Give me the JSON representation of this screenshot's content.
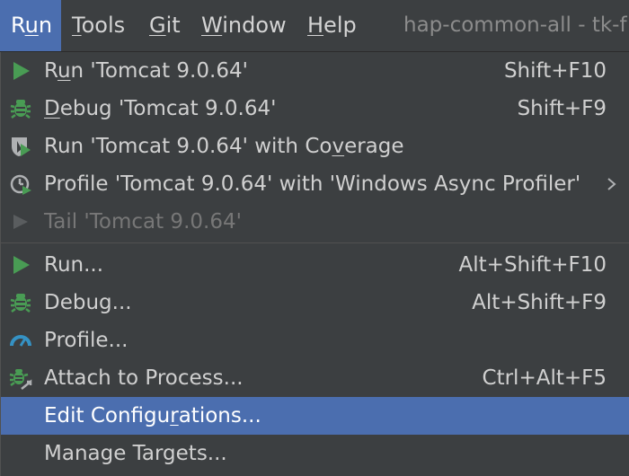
{
  "menubar": {
    "items": [
      {
        "pre": "R",
        "ul": "u",
        "post": "n"
      },
      {
        "pre": "",
        "ul": "T",
        "post": "ools"
      },
      {
        "pre": "",
        "ul": "G",
        "post": "it"
      },
      {
        "pre": "",
        "ul": "W",
        "post": "indow"
      },
      {
        "pre": "",
        "ul": "H",
        "post": "elp"
      }
    ],
    "window_title": "hap-common-all - tk-f"
  },
  "menu": {
    "items": [
      {
        "pre": "R",
        "ul": "u",
        "post": "n 'Tomcat 9.0.64'",
        "shortcut": "Shift+F10",
        "icon": "run-icon"
      },
      {
        "pre": "",
        "ul": "D",
        "post": "ebug 'Tomcat 9.0.64'",
        "shortcut": "Shift+F9",
        "icon": "debug-icon"
      },
      {
        "pre": "Run 'Tomcat 9.0.64' with Co",
        "ul": "v",
        "post": "erage",
        "shortcut": "",
        "icon": "coverage-icon"
      },
      {
        "pre": "Profile 'Tomcat 9.0.64' with 'Windows Async Profiler'",
        "ul": "",
        "post": "",
        "shortcut": "",
        "icon": "profiler-icon"
      },
      {
        "pre": "Tail 'Tomcat 9.0.64'",
        "ul": "",
        "post": "",
        "shortcut": "",
        "icon": "run-icon-disabled"
      },
      {
        "pre": "Run...",
        "ul": "",
        "post": "",
        "shortcut": "Alt+Shift+F10",
        "icon": "run-icon"
      },
      {
        "pre": "Debug...",
        "ul": "",
        "post": "",
        "shortcut": "Alt+Shift+F9",
        "icon": "debug-icon"
      },
      {
        "pre": "Profile...",
        "ul": "",
        "post": "",
        "shortcut": "",
        "icon": "gauge-icon"
      },
      {
        "pre": "Attach to Process...",
        "ul": "",
        "post": "",
        "shortcut": "Ctrl+Alt+F5",
        "icon": "attach-icon"
      },
      {
        "pre": "Edit Configu",
        "ul": "r",
        "post": "ations...",
        "shortcut": "",
        "icon": ""
      },
      {
        "pre": "Manage Targets...",
        "ul": "",
        "post": "",
        "shortcut": "",
        "icon": ""
      }
    ]
  },
  "colors": {
    "background": "#3c3f41",
    "selection": "#4b6eaf",
    "run_green": "#499c54",
    "gauge_blue": "#3592c4",
    "disabled": "#5a5d5f"
  }
}
